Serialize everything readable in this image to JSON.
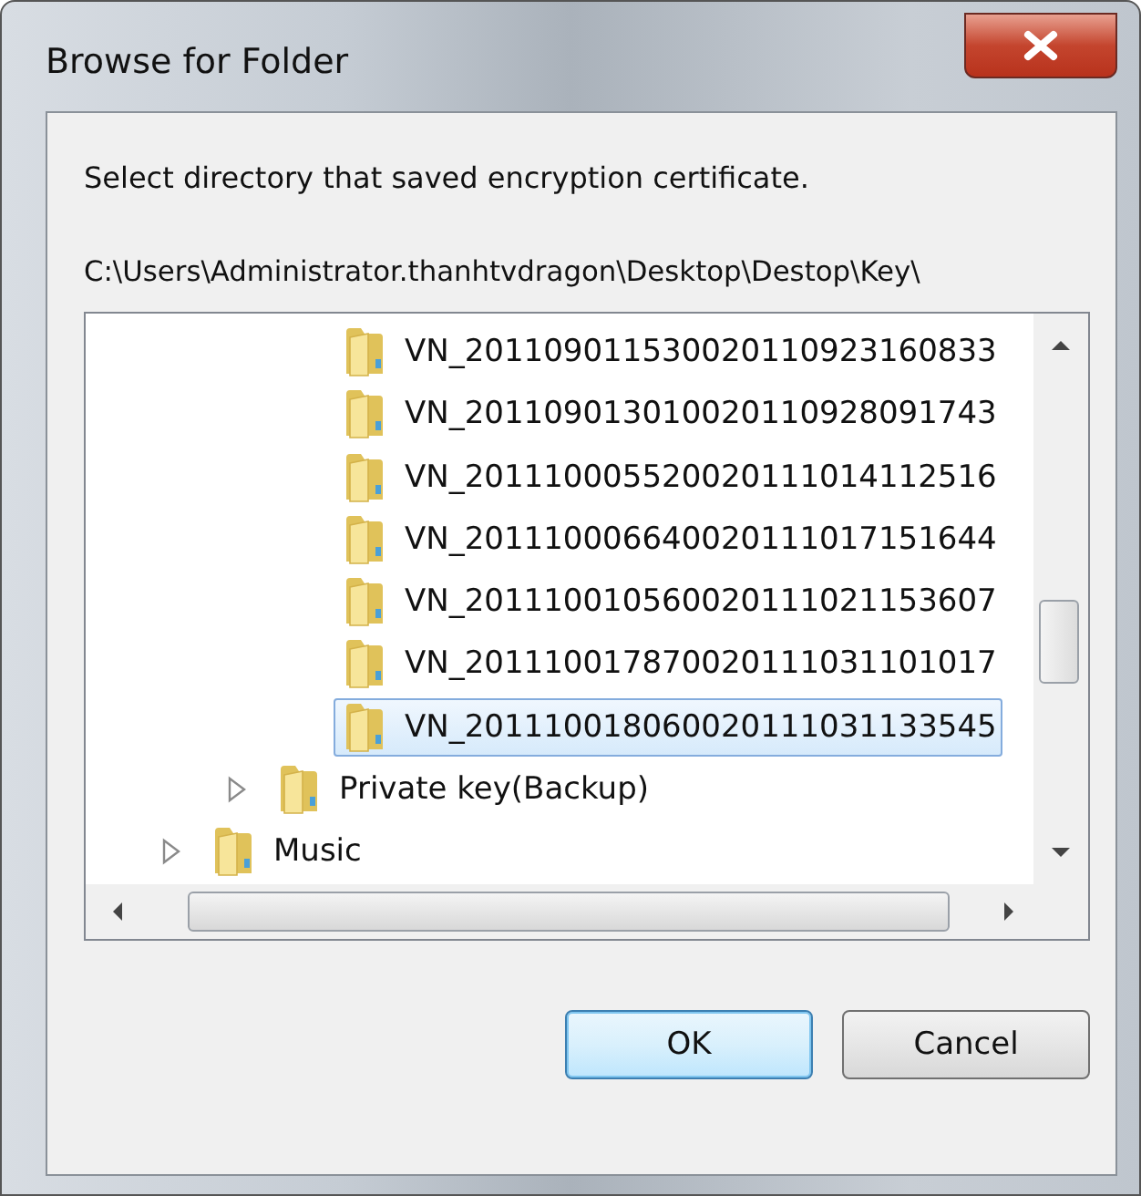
{
  "window": {
    "title": "Browse for Folder"
  },
  "instruction": "Select directory that saved encryption certificate.",
  "path": [
    "C:\\Users\\Administrator.thanhtvdragon\\Desktop\\Destop\\Key\\"
  ],
  "tree": {
    "items": [
      {
        "children": [
          {
            "children": [
              {
                "label": "VN_201109011530020110923160833",
                "kind": "leaf",
                "selected": false
              },
              {
                "label": "VN_201109013010020110928091743",
                "kind": "leaf",
                "selected": false
              },
              {
                "label": "VN_201110005520020111014112516",
                "kind": "leaf",
                "selected": false
              },
              {
                "label": "VN_201110006640020111017151644",
                "kind": "leaf",
                "selected": false
              },
              {
                "label": "VN_201110010560020111021153607",
                "kind": "leaf",
                "selected": false
              },
              {
                "label": "VN_201110017870020111031101017",
                "kind": "leaf",
                "selected": false
              },
              {
                "label": "VN_201110018060020111031133545",
                "kind": "leaf",
                "selected": true
              }
            ]
          },
          {
            "label": "Private key(Backup)",
            "kind": "collapsed",
            "selected": false
          }
        ]
      },
      {
        "label": "Music",
        "kind": "collapsed",
        "selected": false
      }
    ]
  },
  "buttons": [
    {
      "label": "OK",
      "default": true
    },
    {
      "label": "Cancel",
      "default": false
    }
  ]
}
